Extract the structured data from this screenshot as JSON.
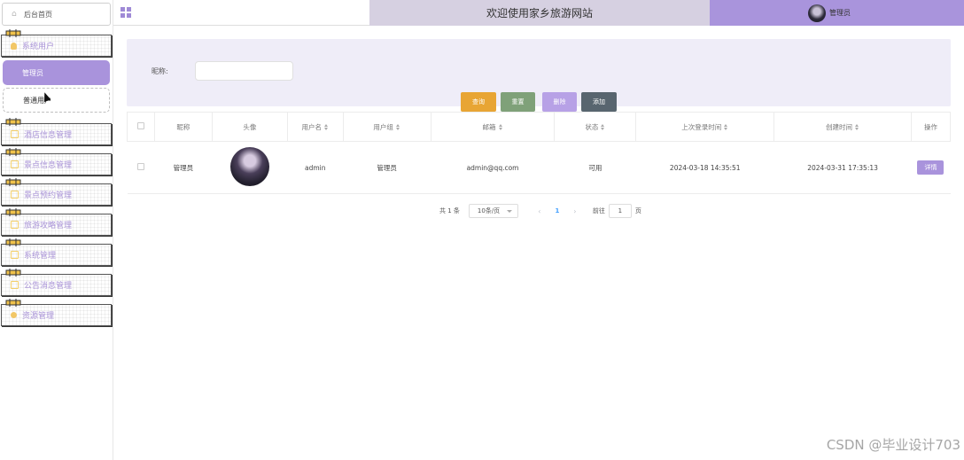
{
  "sidebar": {
    "home": "后台首页",
    "menus": [
      {
        "label": "系统用户",
        "icon": "user-icon"
      },
      {
        "label": "酒店信息管理",
        "icon": "folder-icon"
      },
      {
        "label": "景点信息管理",
        "icon": "folder-icon"
      },
      {
        "label": "景点预约管理",
        "icon": "folder-icon"
      },
      {
        "label": "旅游攻略管理",
        "icon": "folder-icon"
      },
      {
        "label": "系统管理",
        "icon": "folder-icon"
      },
      {
        "label": "公告消息管理",
        "icon": "folder-icon"
      },
      {
        "label": "资源管理",
        "icon": "bulb-icon"
      }
    ],
    "sub_items": [
      "管理员",
      "普通用户"
    ],
    "active_sub": "管理员"
  },
  "header": {
    "title": "欢迎使用家乡旅游网站",
    "user_name": "管理员"
  },
  "search": {
    "nickname_label": "昵称:",
    "nickname_value": "",
    "buttons": {
      "query": "查询",
      "reset": "重置",
      "delete": "删除",
      "add": "添加"
    }
  },
  "table": {
    "headers": [
      "昵称",
      "头像",
      "用户名",
      "用户组",
      "邮箱",
      "状态",
      "上次登录时间",
      "创建时间",
      "操作"
    ],
    "rows": [
      {
        "nickname": "管理员",
        "username": "admin",
        "group": "管理员",
        "email": "admin@qq.com",
        "status": "可用",
        "last_login": "2024-03-18 14:35:51",
        "created": "2024-03-31 17:35:13",
        "action": "详情"
      }
    ]
  },
  "pager": {
    "total": "共 1 条",
    "page_size": "10条/页",
    "current_page": "1",
    "goto_label": "前往",
    "goto_value": "1",
    "page_suffix": "页"
  },
  "watermark": "CSDN @毕业设计703",
  "colors": {
    "accent": "#a993dc",
    "query": "#e8a534",
    "reset": "#7fa179",
    "delete": "#b7a1e6",
    "add": "#58656f"
  }
}
